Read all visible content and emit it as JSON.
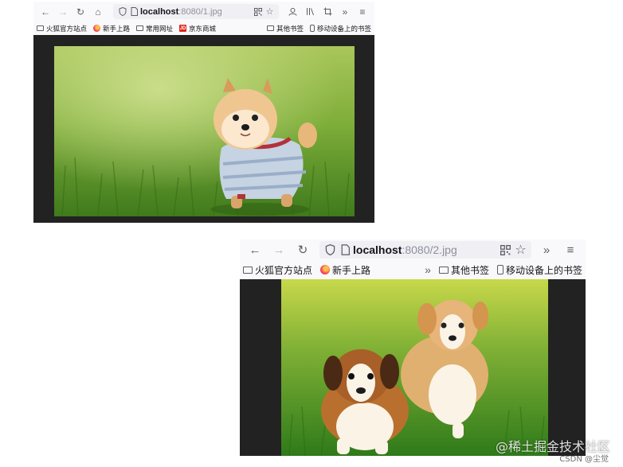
{
  "window1": {
    "url_host": "localhost",
    "url_rest": ":8080/1.jpg",
    "bookmarks": [
      "火狐官方站点",
      "新手上路",
      "常用网址",
      "京东商城"
    ],
    "bookmarks_right": [
      "其他书签",
      "移动设备上的书签"
    ],
    "jd_badge": "JD",
    "image_alt": "Small fluffy dog in a striped sweater standing on grass"
  },
  "window2": {
    "url_host": "localhost",
    "url_rest": ":8080/2.jpg",
    "bookmarks": [
      "火狐官方站点",
      "新手上路"
    ],
    "bookmarks_right": [
      "其他书签",
      "移动设备上的书签"
    ],
    "image_alt": "Two puppies running on grass"
  },
  "icons": {
    "back": "arrow-left",
    "forward": "arrow-right",
    "reload": "reload",
    "home": "home",
    "shield": "shield",
    "page": "page",
    "qr": "qr-code",
    "star": "star",
    "account": "account",
    "library": "library",
    "screenshot": "screenshot",
    "overflow": "chevron-double-right",
    "menu": "hamburger-menu"
  },
  "watermark": "@稀土掘金技术社区",
  "credit": "CSDN @尘觉"
}
